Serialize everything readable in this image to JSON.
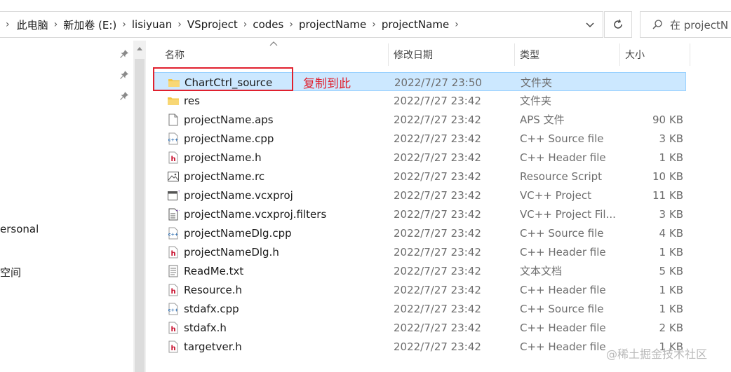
{
  "breadcrumb": [
    "此电脑",
    "新加卷 (E:)",
    "lisiyuan",
    "VSproject",
    "codes",
    "projectName",
    "projectName"
  ],
  "search": {
    "placeholder": "在 projectN"
  },
  "nav": {
    "item_personal": "ersonal",
    "item_space": "空间"
  },
  "columns": {
    "name": "名称",
    "date": "修改日期",
    "type": "类型",
    "size": "大小"
  },
  "files": [
    {
      "name": "ChartCtrl_source",
      "date": "2022/7/27 23:50",
      "type": "文件夹",
      "size": "",
      "icon": "folder-icon",
      "selected": true
    },
    {
      "name": "res",
      "date": "2022/7/27 23:42",
      "type": "文件夹",
      "size": "",
      "icon": "folder-icon",
      "selected": false
    },
    {
      "name": "projectName.aps",
      "date": "2022/7/27 23:42",
      "type": "APS 文件",
      "size": "90 KB",
      "icon": "blank-file-icon",
      "selected": false
    },
    {
      "name": "projectName.cpp",
      "date": "2022/7/27 23:42",
      "type": "C++ Source file",
      "size": "3 KB",
      "icon": "cpp-file-icon",
      "selected": false
    },
    {
      "name": "projectName.h",
      "date": "2022/7/27 23:42",
      "type": "C++ Header file",
      "size": "1 KB",
      "icon": "header-file-icon",
      "selected": false
    },
    {
      "name": "projectName.rc",
      "date": "2022/7/27 23:42",
      "type": "Resource Script",
      "size": "10 KB",
      "icon": "resource-file-icon",
      "selected": false
    },
    {
      "name": "projectName.vcxproj",
      "date": "2022/7/27 23:42",
      "type": "VC++ Project",
      "size": "11 KB",
      "icon": "vcxproj-file-icon",
      "selected": false
    },
    {
      "name": "projectName.vcxproj.filters",
      "date": "2022/7/27 23:42",
      "type": "VC++ Project Fil...",
      "size": "3 KB",
      "icon": "filters-file-icon",
      "selected": false
    },
    {
      "name": "projectNameDlg.cpp",
      "date": "2022/7/27 23:42",
      "type": "C++ Source file",
      "size": "4 KB",
      "icon": "cpp-file-icon",
      "selected": false
    },
    {
      "name": "projectNameDlg.h",
      "date": "2022/7/27 23:42",
      "type": "C++ Header file",
      "size": "1 KB",
      "icon": "header-file-icon",
      "selected": false
    },
    {
      "name": "ReadMe.txt",
      "date": "2022/7/27 23:42",
      "type": "文本文档",
      "size": "5 KB",
      "icon": "text-file-icon",
      "selected": false
    },
    {
      "name": "Resource.h",
      "date": "2022/7/27 23:42",
      "type": "C++ Header file",
      "size": "1 KB",
      "icon": "header-file-icon",
      "selected": false
    },
    {
      "name": "stdafx.cpp",
      "date": "2022/7/27 23:42",
      "type": "C++ Source file",
      "size": "1 KB",
      "icon": "cpp-file-icon",
      "selected": false
    },
    {
      "name": "stdafx.h",
      "date": "2022/7/27 23:42",
      "type": "C++ Header file",
      "size": "2 KB",
      "icon": "header-file-icon",
      "selected": false
    },
    {
      "name": "targetver.h",
      "date": "2022/7/27 23:42",
      "type": "C++ Header file",
      "size": "1 KB",
      "icon": "header-file-icon",
      "selected": false
    }
  ],
  "annotation": {
    "text": "复制到此",
    "color": "#e0202e"
  },
  "watermark": "@稀土掘金技术社区",
  "colors": {
    "selection": "#cce8ff",
    "selection_border": "#99d1ff",
    "folder": "#f4c542",
    "header_icon": "#c8102e",
    "cpp_icon": "#2b6cb0"
  }
}
